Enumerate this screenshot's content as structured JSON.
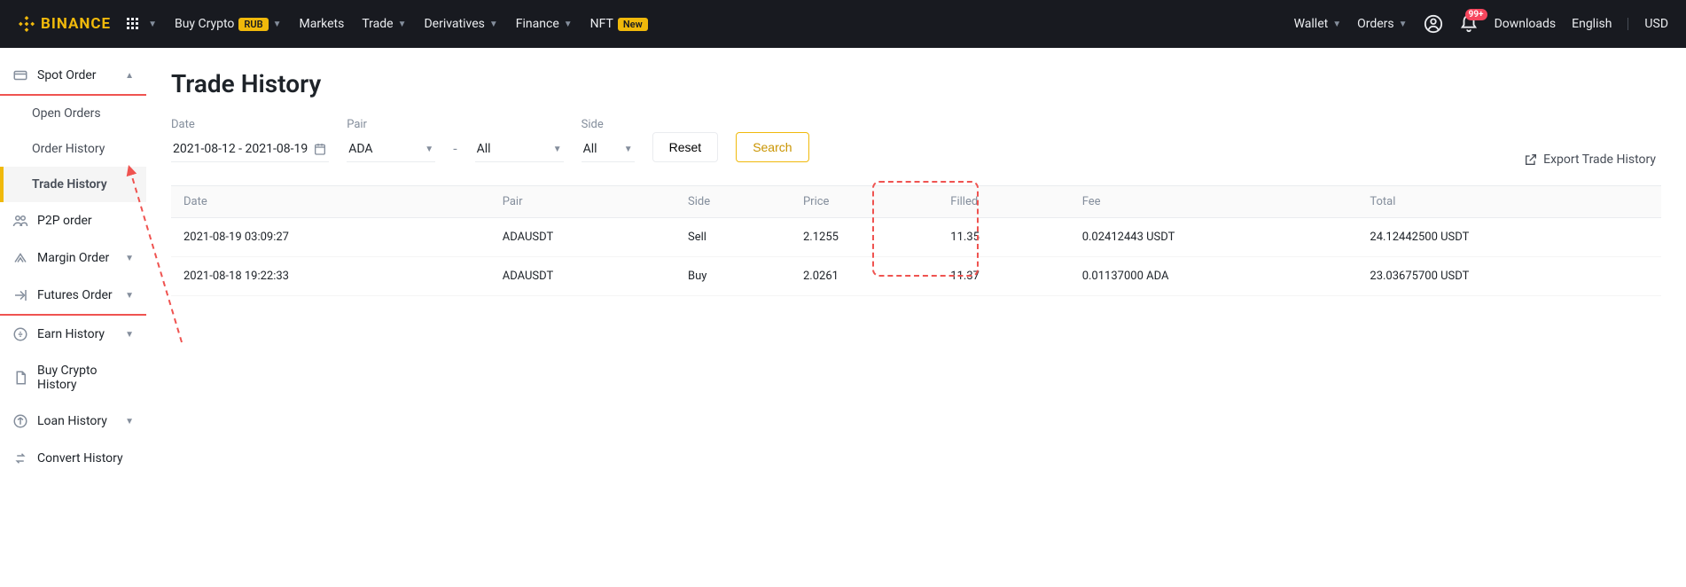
{
  "brand": "BINANCE",
  "header": {
    "nav": [
      {
        "label": "Buy Crypto",
        "badge": "RUB",
        "has_caret": true
      },
      {
        "label": "Markets",
        "badge": null,
        "has_caret": false
      },
      {
        "label": "Trade",
        "badge": null,
        "has_caret": true
      },
      {
        "label": "Derivatives",
        "badge": null,
        "has_caret": true
      },
      {
        "label": "Finance",
        "badge": null,
        "has_caret": true
      },
      {
        "label": "NFT",
        "badge": "New",
        "has_caret": false
      }
    ],
    "wallet": "Wallet",
    "orders": "Orders",
    "downloads": "Downloads",
    "language": "English",
    "currency": "USD",
    "bell_badge": "99+"
  },
  "sidebar": {
    "spot_order": "Spot Order",
    "open_orders": "Open Orders",
    "order_history": "Order History",
    "trade_history": "Trade History",
    "p2p_order": "P2P order",
    "margin_order": "Margin Order",
    "futures_order": "Futures Order",
    "earn_history": "Earn History",
    "buy_crypto_history": "Buy Crypto History",
    "loan_history": "Loan History",
    "convert_history": "Convert History"
  },
  "page": {
    "title": "Trade History",
    "labels": {
      "date": "Date",
      "pair": "Pair",
      "side": "Side"
    },
    "date_range": "2021-08-12 - 2021-08-19",
    "pair_selected": "ADA",
    "pair2_selected": "All",
    "side_selected": "All",
    "reset": "Reset",
    "search": "Search",
    "export": "Export Trade History"
  },
  "table": {
    "headers": {
      "date": "Date",
      "pair": "Pair",
      "side": "Side",
      "price": "Price",
      "filled": "Filled",
      "fee": "Fee",
      "total": "Total"
    },
    "rows": [
      {
        "date": "2021-08-19 03:09:27",
        "pair": "ADAUSDT",
        "side": "Sell",
        "price": "2.1255",
        "filled": "11.35",
        "fee": "0.02412443 USDT",
        "total": "24.12442500 USDT"
      },
      {
        "date": "2021-08-18 19:22:33",
        "pair": "ADAUSDT",
        "side": "Buy",
        "price": "2.0261",
        "filled": "11.37",
        "fee": "0.01137000 ADA",
        "total": "23.03675700 USDT"
      }
    ]
  }
}
